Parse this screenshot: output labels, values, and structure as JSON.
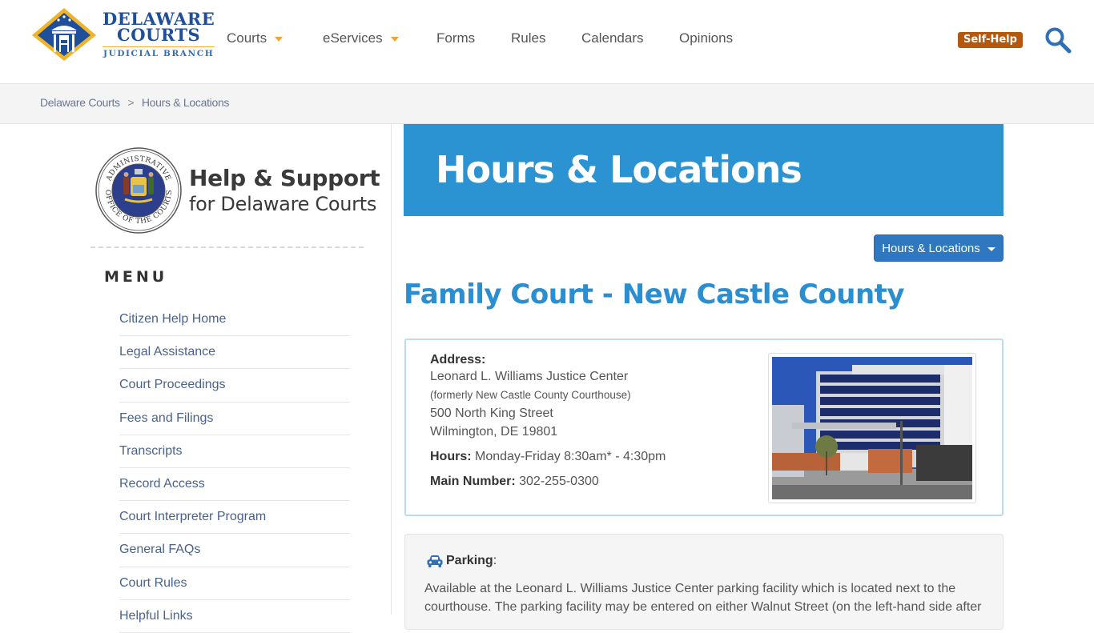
{
  "header": {
    "logo": {
      "line1": "DELAWARE",
      "line2": "COURTS",
      "line3": "JUDICIAL BRANCH"
    },
    "nav": [
      {
        "label": "Courts",
        "has_dropdown": true
      },
      {
        "label": "eServices",
        "has_dropdown": true
      },
      {
        "label": "Forms",
        "has_dropdown": false
      },
      {
        "label": "Rules",
        "has_dropdown": false
      },
      {
        "label": "Calendars",
        "has_dropdown": false
      },
      {
        "label": "Opinions",
        "has_dropdown": false
      }
    ],
    "self_help_label": "Self-Help",
    "search_icon": "search-icon",
    "colors": {
      "brand_blue": "#1f4f9a",
      "caret_orange": "#f2a531",
      "self_help_bg": "#b5580f",
      "search_blue": "#2f6fb3"
    }
  },
  "breadcrumb": {
    "items": [
      "Delaware Courts",
      "Hours & Locations"
    ],
    "separator": ">"
  },
  "sidebar": {
    "brand": {
      "seal_top_text": "ADMINISTRATIVE",
      "seal_bottom_text": "OFFICE OF THE COURTS",
      "title": "Help & Support",
      "subtitle": "for Delaware Courts"
    },
    "menu_title": "MENU",
    "menu_items": [
      "Citizen Help Home",
      "Legal Assistance",
      "Court Proceedings",
      "Fees and Filings",
      "Transcripts",
      "Record Access",
      "Court Interpreter Program",
      "General FAQs",
      "Court Rules",
      "Helpful Links"
    ]
  },
  "main": {
    "banner": {
      "bold": "Hours",
      "rest": " & Locations",
      "color": "#2b93d1"
    },
    "location_dropdown": {
      "label": "Hours & Locations"
    },
    "court": {
      "name": "Family Court",
      "suffix": " - New Castle County",
      "color": "#2b8ed0"
    },
    "info": {
      "address_label": "Address:",
      "address_lines": [
        "Leonard L. Williams Justice Center",
        "(formerly New Castle County Courthouse)",
        "500 North King Street",
        "Wilmington, DE 19801"
      ],
      "hours_label": "Hours:",
      "hours_value": " Monday-Friday 8:30am* - 4:30pm",
      "phone_label": "Main Number:",
      "phone_value": " 302-255-0300",
      "photo_alt": "Leonard L. Williams Justice Center building"
    },
    "parking": {
      "icon": "car-icon",
      "label": "Parking",
      "suffix": ":",
      "text": "Available at the Leonard L. Williams Justice Center parking facility which is located next to the courthouse. The parking facility may be entered on either Walnut Street (on the left-hand side after"
    }
  }
}
